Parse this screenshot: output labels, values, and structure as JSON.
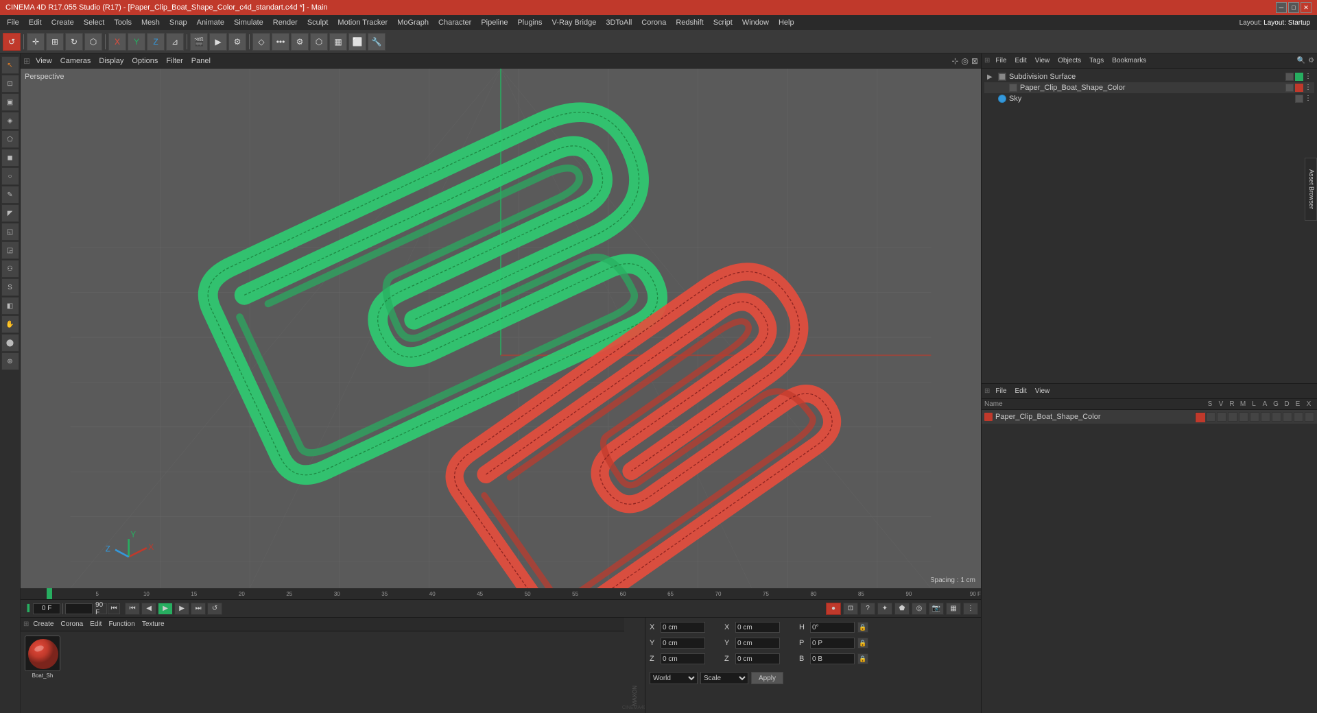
{
  "titleBar": {
    "title": "CINEMA 4D R17.055 Studio (R17) - [Paper_Clip_Boat_Shape_Color_c4d_standart.c4d *] - Main",
    "controls": [
      "minimize",
      "maximize",
      "close"
    ]
  },
  "menuBar": {
    "items": [
      "File",
      "Edit",
      "Create",
      "Select",
      "Tools",
      "Mesh",
      "Snap",
      "Animate",
      "Simulate",
      "Render",
      "Sculpt",
      "Motion Tracker",
      "MoGraph",
      "Character",
      "Pipeline",
      "Plugins",
      "V-Ray Bridge",
      "3DToAll",
      "Corona",
      "Redshift",
      "Script",
      "Window",
      "Help"
    ]
  },
  "rightPanel": {
    "topToolbar": {
      "items": [
        "File",
        "Edit",
        "View",
        "Objects",
        "Tags",
        "Bookmarks"
      ]
    },
    "layoutLabel": "Layout: Startup",
    "objects": [
      {
        "name": "Subdivision Surface",
        "color": "#27ae60",
        "level": 0
      },
      {
        "name": "Paper_Clip_Boat_Shape_Color",
        "color": "#c0392b",
        "level": 1
      },
      {
        "name": "Sky",
        "color": "#3498db",
        "level": 0
      }
    ],
    "bottomToolbar": {
      "items": [
        "File",
        "Edit",
        "View"
      ]
    },
    "materialColumns": [
      "Name",
      "S",
      "V",
      "R",
      "M",
      "L",
      "A",
      "G",
      "D",
      "E",
      "X"
    ],
    "materials": [
      {
        "name": "Paper_Clip_Boat_Shape_Color",
        "color": "#c0392b"
      }
    ]
  },
  "viewport": {
    "label": "Perspective",
    "gridSpacing": "Grid Spacing : 1 cm",
    "viewToolbar": [
      "View",
      "Cameras",
      "Display",
      "Options",
      "Filter",
      "Panel"
    ]
  },
  "timeline": {
    "markers": [
      "0",
      "5",
      "10",
      "15",
      "20",
      "25",
      "30",
      "35",
      "40",
      "45",
      "50",
      "55",
      "60",
      "65",
      "70",
      "75",
      "80",
      "85",
      "90"
    ],
    "endFrame": "90 F",
    "currentFrame": "0 F"
  },
  "bottomMenuBar": {
    "items": [
      "Create",
      "Corona",
      "Edit",
      "Function",
      "Texture"
    ]
  },
  "materialEditor": {
    "thumbnail": "Boat_Sh",
    "thumbnailBg": "#c0392b"
  },
  "coords": {
    "xLabel": "X",
    "yLabel": "Y",
    "zLabel": "Z",
    "xVal": "0 cm",
    "yVal": "0 cm",
    "zVal": "0 cm",
    "hVal": "0°",
    "pVal": "0 P",
    "bVal": "0 B",
    "x2Label": "X",
    "y2Label": "Y",
    "z2Label": "Z",
    "x2Val": "0 cm",
    "y2Val": "0 cm",
    "z2Val": "0 cm",
    "worldLabel": "World",
    "scaleLabel": "Scale",
    "applyLabel": "Apply"
  }
}
